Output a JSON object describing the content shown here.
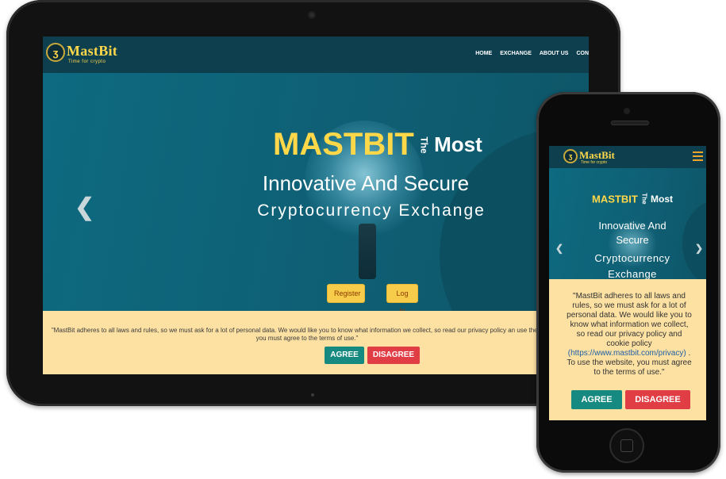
{
  "brand": {
    "name": "MastBit",
    "tagline": "Time for crypto",
    "logo_glyph": "ʒ"
  },
  "tablet": {
    "nav": {
      "items": [
        "HOME",
        "EXCHANGE",
        "ABOUT US",
        "CON"
      ]
    },
    "hero": {
      "title_main": "MASTBIT",
      "title_the": "The",
      "title_most": "Most",
      "line2": "Innovative And Secure",
      "line3": "Cryptocurrency Exchange",
      "prev_arrow": "❮",
      "register_label": "Register",
      "login_label": "Log In"
    },
    "cookie": {
      "text": "\"MastBit adheres to all laws and rules, so we must ask for a lot of personal data. We would like you to know what information we collect, so read our privacy policy an use the website, you must agree to the terms of use.\"",
      "agree_label": "AGREE",
      "disagree_label": "DISAGREE"
    }
  },
  "phone": {
    "hero": {
      "title_main": "MASTBIT",
      "title_the": "The",
      "title_most": "Most",
      "line2": "Innovative And Secure",
      "line3": "Cryptocurrency Exchange",
      "prev_arrow": "❮",
      "next_arrow": "❯"
    },
    "cookie": {
      "text_before": "\"MastBit adheres to all laws and rules, so we must ask for a lot of personal data. We would like you to know what information we collect, so read our privacy policy and cookie policy",
      "link": "(https://www.mastbit.com/privacy)",
      "text_after": ". To use the website, you must agree to the terms of use.\"",
      "agree_label": "AGREE",
      "disagree_label": "DISAGREE"
    }
  },
  "colors": {
    "nav_bg": "#0e3f4f",
    "hero_bg": "#0f5f74",
    "accent_yellow": "#ffd84a",
    "cookie_bg": "#fde1a3",
    "agree_bg": "#168a80",
    "disagree_bg": "#e03d45"
  }
}
